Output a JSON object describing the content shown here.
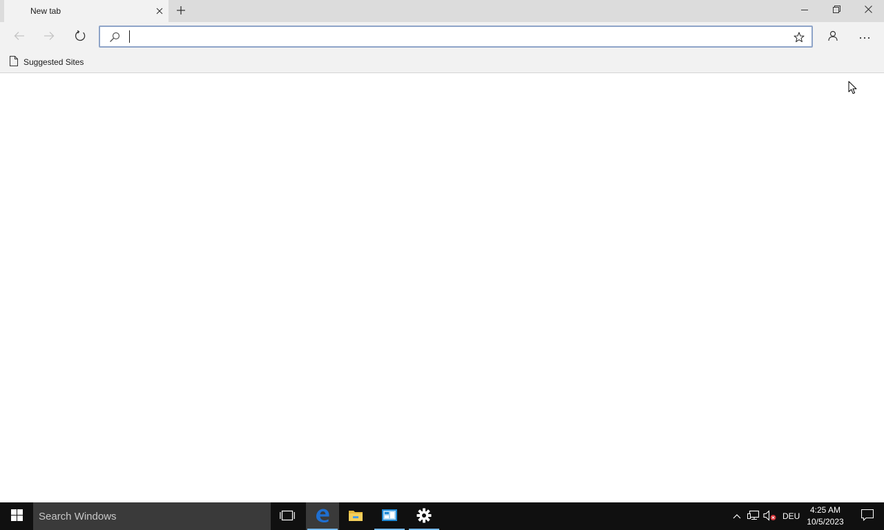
{
  "browser": {
    "tab": {
      "title": "New tab"
    },
    "address_bar": {
      "value": "",
      "placeholder": ""
    },
    "favorites_bar": {
      "items": [
        {
          "label": "Suggested Sites"
        }
      ]
    },
    "icons": {
      "tab_close": "close-icon",
      "new_tab": "plus-icon",
      "minimize": "minimize-icon",
      "restore": "restore-icon",
      "close": "close-icon",
      "back": "arrow-left-icon",
      "forward": "arrow-right-icon",
      "refresh": "refresh-icon",
      "search": "search-icon",
      "favorite": "star-icon",
      "profile": "person-icon",
      "more": "more-icon"
    }
  },
  "taskbar": {
    "search_placeholder": "Search Windows",
    "apps": [
      {
        "name": "Task View",
        "icon": "task-view-icon"
      },
      {
        "name": "Microsoft Edge",
        "icon": "edge-icon",
        "active": true
      },
      {
        "name": "File Explorer",
        "icon": "folder-icon"
      },
      {
        "name": "Server Manager",
        "icon": "server-manager-icon"
      },
      {
        "name": "Settings",
        "icon": "gear-icon"
      }
    ],
    "tray": {
      "language": "DEU",
      "time": "4:25 AM",
      "date": "10/5/2023"
    }
  },
  "colors": {
    "title_bar": "#dcdcdc",
    "toolbar": "#f2f2f2",
    "address_border": "#8ea4c8",
    "taskbar": "#101010",
    "taskbar_accent": "#76b9ed",
    "edge_blue": "#1f6fd1"
  }
}
